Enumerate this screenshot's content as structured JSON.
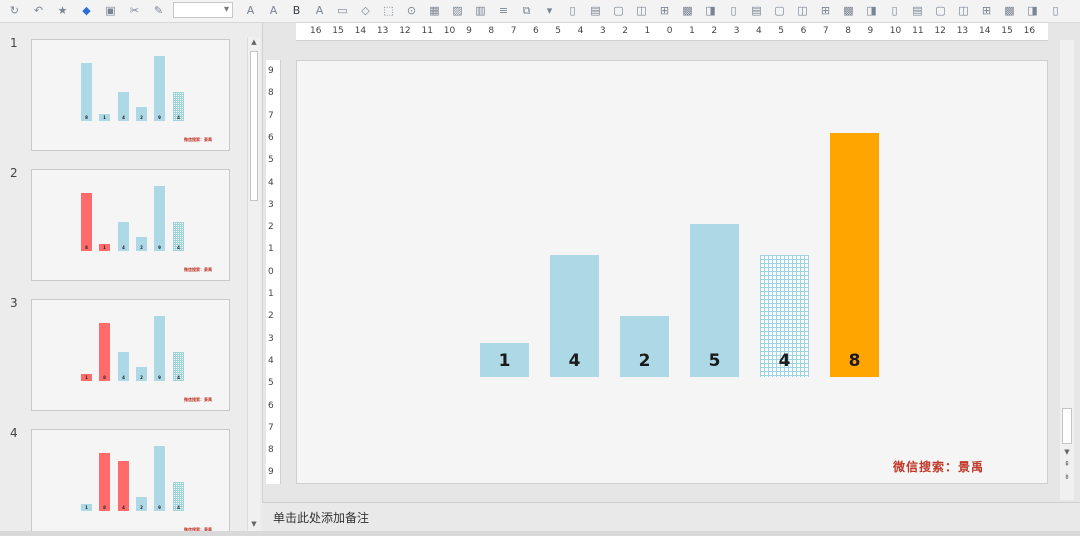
{
  "toolbar": {
    "icons": [
      "refresh-icon",
      "undo-icon",
      "format-painter-icon",
      "shapes-icon",
      "slide-layout-icon",
      "cut-icon",
      "pen-icon",
      "increase-font-icon",
      "decrease-font-icon",
      "bold-icon",
      "font-color-icon",
      "text-box-icon",
      "shape-icon",
      "select-icon",
      "link-icon",
      "table-icon",
      "picture-icon",
      "chart-icon",
      "align-icon",
      "arrange-icon",
      "more-icon"
    ],
    "font_size_value": ""
  },
  "slides_panel": {
    "slides": [
      {
        "number": "1",
        "values": [
          8,
          1,
          4,
          2,
          9,
          4
        ],
        "labels": [
          "8",
          "1",
          "4",
          "2",
          "9",
          "4"
        ],
        "colors": [
          "#add8e6",
          "#add8e6",
          "#add8e6",
          "#add8e6",
          "#add8e6",
          "grid"
        ]
      },
      {
        "number": "2",
        "values": [
          8,
          1,
          4,
          2,
          9,
          4
        ],
        "labels": [
          "8",
          "1",
          "4",
          "2",
          "9",
          "4"
        ],
        "colors": [
          "#ff6b6b",
          "#ff6b6b",
          "#add8e6",
          "#add8e6",
          "#add8e6",
          "grid"
        ]
      },
      {
        "number": "3",
        "values": [
          1,
          8,
          4,
          2,
          9,
          4
        ],
        "labels": [
          "1",
          "8",
          "4",
          "2",
          "9",
          "4"
        ],
        "colors": [
          "#ff6b6b",
          "#ff6b6b",
          "#add8e6",
          "#add8e6",
          "#add8e6",
          "grid"
        ]
      },
      {
        "number": "4",
        "values": [
          1,
          8,
          7,
          2,
          9,
          4
        ],
        "labels": [
          "1",
          "8",
          "4",
          "2",
          "9",
          "4"
        ],
        "colors": [
          "#add8e6",
          "#ff6b6b",
          "#ff6b6b",
          "#add8e6",
          "#add8e6",
          "grid"
        ]
      }
    ],
    "watermark": "微信搜索：景禹"
  },
  "ruler": {
    "h_labels": [
      "16",
      "15",
      "14",
      "13",
      "12",
      "11",
      "10",
      "9",
      "8",
      "7",
      "6",
      "5",
      "4",
      "3",
      "2",
      "1",
      "0",
      "1",
      "2",
      "3",
      "4",
      "5",
      "6",
      "7",
      "8",
      "9",
      "10",
      "11",
      "12",
      "13",
      "14",
      "15",
      "16"
    ],
    "v_labels": [
      "9",
      "8",
      "7",
      "6",
      "5",
      "4",
      "3",
      "2",
      "1",
      "0",
      "1",
      "2",
      "3",
      "4",
      "5",
      "6",
      "7",
      "8",
      "9"
    ]
  },
  "slide": {
    "bars": [
      {
        "label": "1",
        "value": 1,
        "color": "#add8e6",
        "style": "solid"
      },
      {
        "label": "4",
        "value": 4,
        "color": "#add8e6",
        "style": "solid"
      },
      {
        "label": "2",
        "value": 2,
        "color": "#add8e6",
        "style": "solid"
      },
      {
        "label": "5",
        "value": 5,
        "color": "#add8e6",
        "style": "solid"
      },
      {
        "label": "4",
        "value": 4,
        "color": "#add8e6",
        "style": "grid"
      },
      {
        "label": "8",
        "value": 8,
        "color": "#ffa500",
        "style": "solid"
      }
    ],
    "watermark": "微信搜索：景禹"
  },
  "notes": {
    "placeholder": "单击此处添加备注"
  }
}
